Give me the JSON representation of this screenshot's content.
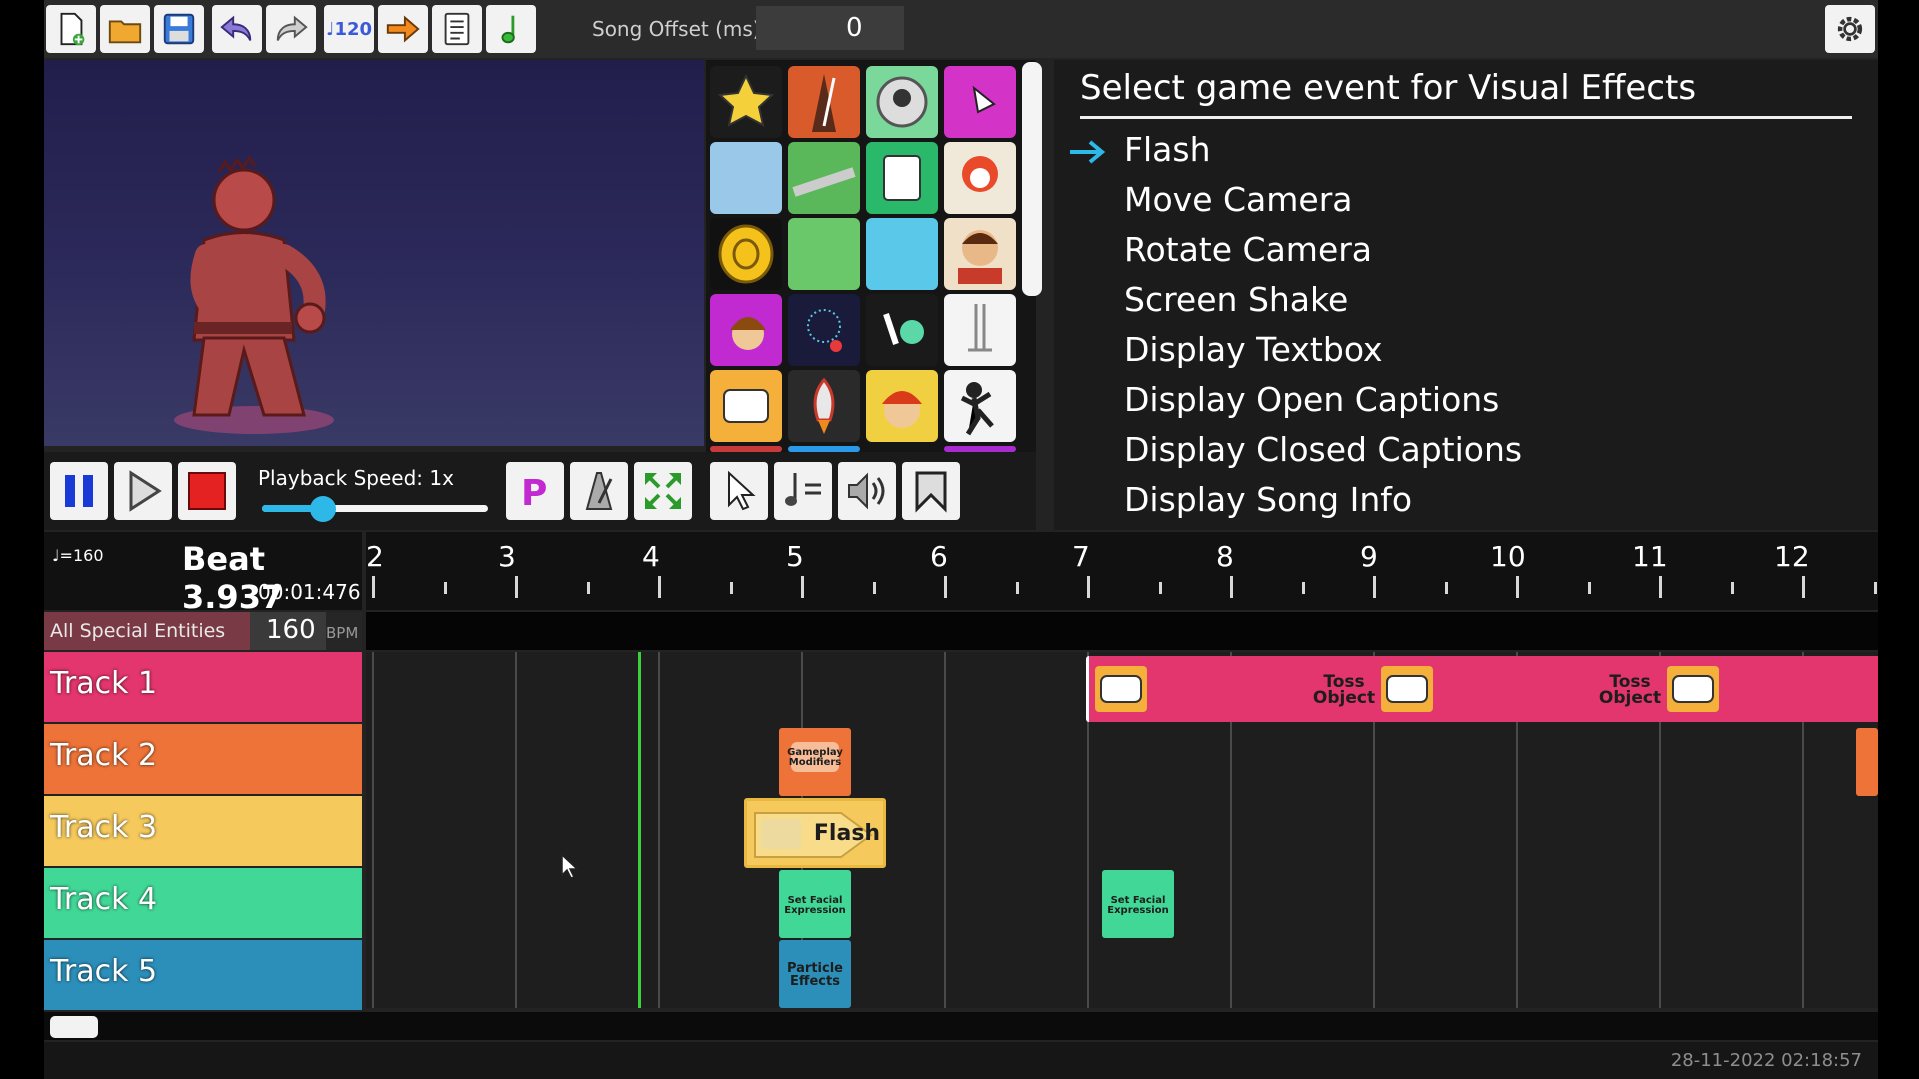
{
  "toolbar": {
    "buttons": [
      "new-file-icon",
      "open-folder-icon",
      "save-icon",
      "undo-icon",
      "redo-icon",
      "tempo-change-icon",
      "jump-arrow-icon",
      "properties-doc-icon",
      "music-note-icon"
    ],
    "tempo_badge": "♩120",
    "offset_label": "Song Offset (ms)",
    "offset_value": "0",
    "settings_icon": "gear-icon"
  },
  "playback": {
    "speed_label": "Playback Speed: 1x",
    "speed_value": 0.27,
    "buttons": [
      "pause-icon",
      "play-icon",
      "stop-icon",
      "p-mode-icon",
      "metronome-icon",
      "fullscreen-icon",
      "select-cursor-icon",
      "tempo-tool-icon",
      "volume-icon",
      "bookmark-icon"
    ]
  },
  "event_panel": {
    "title": "Select game event for Visual Effects",
    "items": [
      "Flash",
      "Move Camera",
      "Rotate Camera",
      "Screen Shake",
      "Display Textbox",
      "Display Open Captions",
      "Display Closed Captions",
      "Display Song Info"
    ],
    "selected_index": 0
  },
  "timeline": {
    "tempo_small": "♩=160",
    "beat": "Beat 3.937",
    "time": "00:01:476",
    "ruler_numbers": [
      "2",
      "3",
      "4",
      "5",
      "6",
      "7",
      "8",
      "9",
      "10",
      "11",
      "12"
    ],
    "special_label": "All Special Entities",
    "bpm_value": "160",
    "bpm_unit": "BPM",
    "tracks": [
      {
        "label": "Track 1",
        "color": "#e3356e"
      },
      {
        "label": "Track 2",
        "color": "#ee7338"
      },
      {
        "label": "Track 3",
        "color": "#f5c95c"
      },
      {
        "label": "Track 4",
        "color": "#41d897"
      },
      {
        "label": "Track 5",
        "color": "#2c8fba"
      }
    ],
    "events": {
      "toss_object_1": "Toss\nObject",
      "toss_object_2": "Toss\nObject",
      "gameplay_modifiers": "Gameplay\nModifiers",
      "flash": "Flash",
      "set_facial_1": "Set Facial\nExpression",
      "set_facial_2": "Set Facial\nExpression",
      "particle_effects": "Particle\nEffects"
    }
  },
  "footer": {
    "timestamp": "28-11-2022 02:18:57"
  },
  "colors": {
    "accent_blue": "#2db8e8",
    "playhead_green": "#3ad13a",
    "stop_red": "#e52222",
    "p_magenta": "#c02ad0"
  }
}
